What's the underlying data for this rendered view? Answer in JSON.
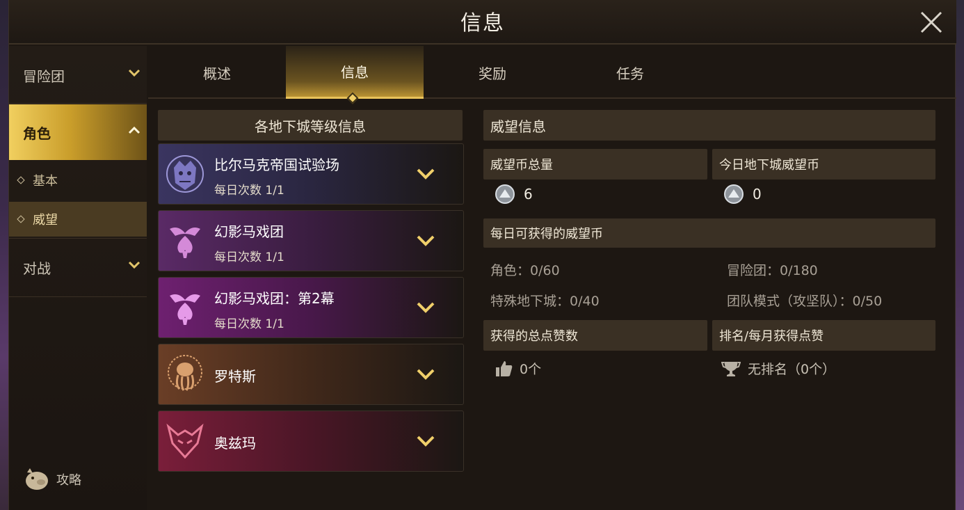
{
  "window": {
    "title": "信息"
  },
  "sidebar": {
    "groups": [
      {
        "label": "冒险团"
      },
      {
        "label": "角色"
      },
      {
        "label": "对战"
      }
    ],
    "subs": [
      {
        "label": "基本"
      },
      {
        "label": "威望"
      }
    ],
    "guide_label": "攻略"
  },
  "tabs": [
    {
      "label": "概述"
    },
    {
      "label": "信息"
    },
    {
      "label": "奖励"
    },
    {
      "label": "任务"
    }
  ],
  "dungeon_list": {
    "header": "各地下城等级信息",
    "items": [
      {
        "name": "比尔马克帝国试验场",
        "count": "每日次数 1/1",
        "color": "#3a3560"
      },
      {
        "name": "幻影马戏团",
        "count": "每日次数 1/1",
        "color": "#5a2a66"
      },
      {
        "name": "幻影马戏团：第2幕",
        "count": "每日次数 1/1",
        "color": "#6e2070"
      },
      {
        "name": "罗特斯",
        "count": "",
        "color": "#6a3e26"
      },
      {
        "name": "奥兹玛",
        "count": "",
        "color": "#7a1e3a"
      }
    ]
  },
  "prestige": {
    "title": "威望信息",
    "total_label": "威望币总量",
    "total_value": "6",
    "today_label": "今日地下城威望币",
    "today_value": "0",
    "daily_label": "每日可获得的威望币",
    "daily_stats": [
      {
        "label": "角色：0/60"
      },
      {
        "label": "冒险团：0/180"
      },
      {
        "label": "特殊地下城：0/40"
      },
      {
        "label": "团队模式（攻坚队）：0/50"
      }
    ],
    "likes_label": "获得的总点赞数",
    "likes_value": "0个",
    "rank_label": "排名/每月获得点赞",
    "rank_value": "无排名（0个）"
  },
  "colors": {
    "accent": "#e8c25a",
    "panel": "#3a3024"
  }
}
